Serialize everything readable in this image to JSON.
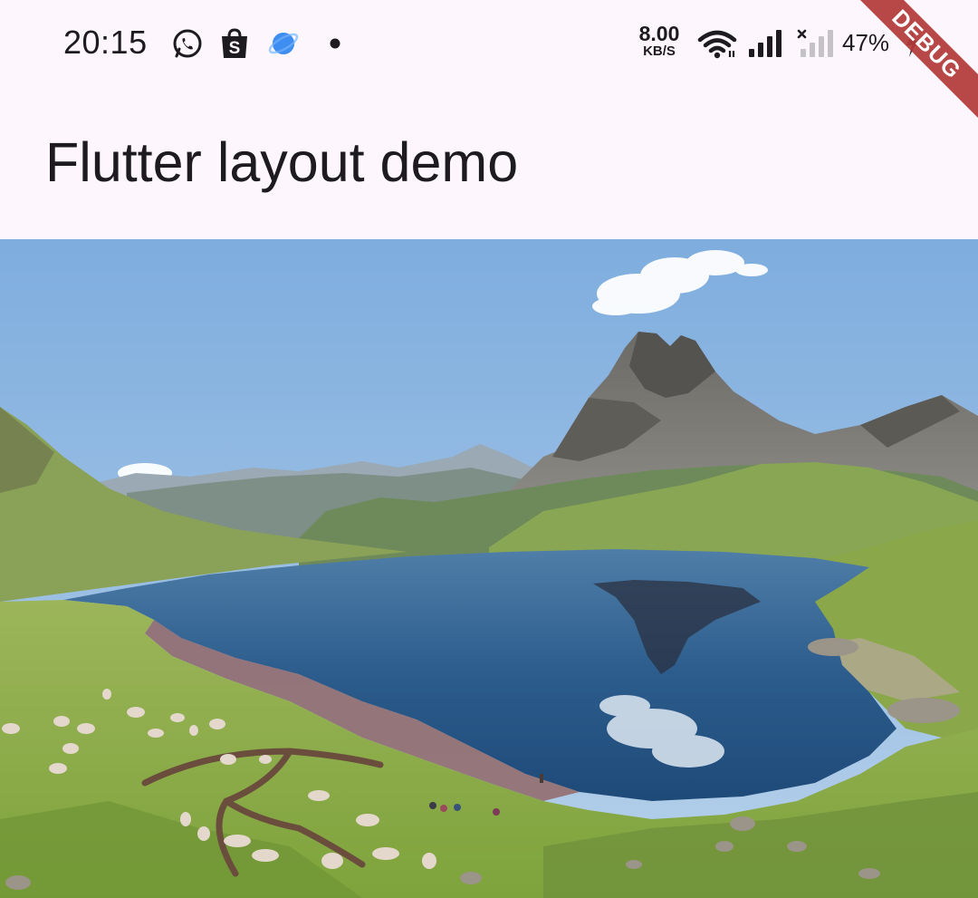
{
  "status_bar": {
    "time": "20:15",
    "notification_icons": [
      "whatsapp-icon",
      "shopee-icon",
      "browser-icon",
      "more-dot-icon"
    ],
    "net_speed_value": "8.00",
    "net_speed_unit": "KB/S",
    "battery_percent": "47%"
  },
  "debug_banner": {
    "label": "DEBUG",
    "color": "#b33b3b"
  },
  "app_bar": {
    "title": "Flutter layout demo"
  },
  "hero_image": {
    "subject": "mountain-lake-landscape"
  },
  "colors": {
    "background": "#fdf7fd",
    "text": "#1d1b20",
    "sky": "#8fb8e4",
    "lake": "#2f5e8c",
    "meadow": "#8aad45"
  }
}
